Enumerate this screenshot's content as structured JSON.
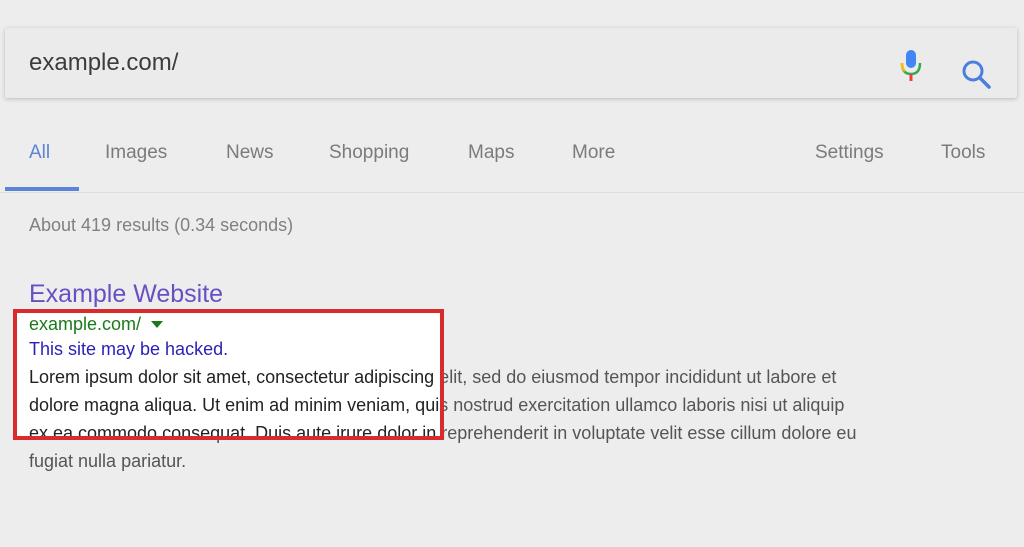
{
  "search": {
    "query": "example.com/",
    "mic_icon": "microphone-icon",
    "search_icon": "magnifier-icon"
  },
  "tabs": [
    {
      "label": "All",
      "active": true
    },
    {
      "label": "Images"
    },
    {
      "label": "News"
    },
    {
      "label": "Shopping"
    },
    {
      "label": "Maps"
    },
    {
      "label": "More"
    }
  ],
  "tools": {
    "settings": "Settings",
    "tools": "Tools"
  },
  "results": {
    "stats": "About 419 results (0.34 seconds)",
    "first": {
      "title": "Example Website",
      "url": "example.com/",
      "warning": "This site may be hacked.",
      "snippet_line1": "Lorem ipsum dolor sit amet, consectetur adipiscing elit, sed do eiusmod tempor incididunt ut labore et",
      "snippet_line2": "dolore magna aliqua. Ut enim ad minim veniam, quis nostrud exercitation ullamco laboris nisi ut aliquip",
      "snippet_line3": "ex ea commodo consequat. Duis aute irure dolor in reprehenderit in voluptate velit esse cillum dolore eu",
      "snippet_line4": "fugiat nulla pariatur."
    }
  },
  "colors": {
    "accent_blue": "#5b84d8",
    "title_purple": "#6a4fc4",
    "url_green": "#1a7a1a",
    "warning_blue": "#2a1fb8",
    "highlight_red": "#d92b2b"
  }
}
